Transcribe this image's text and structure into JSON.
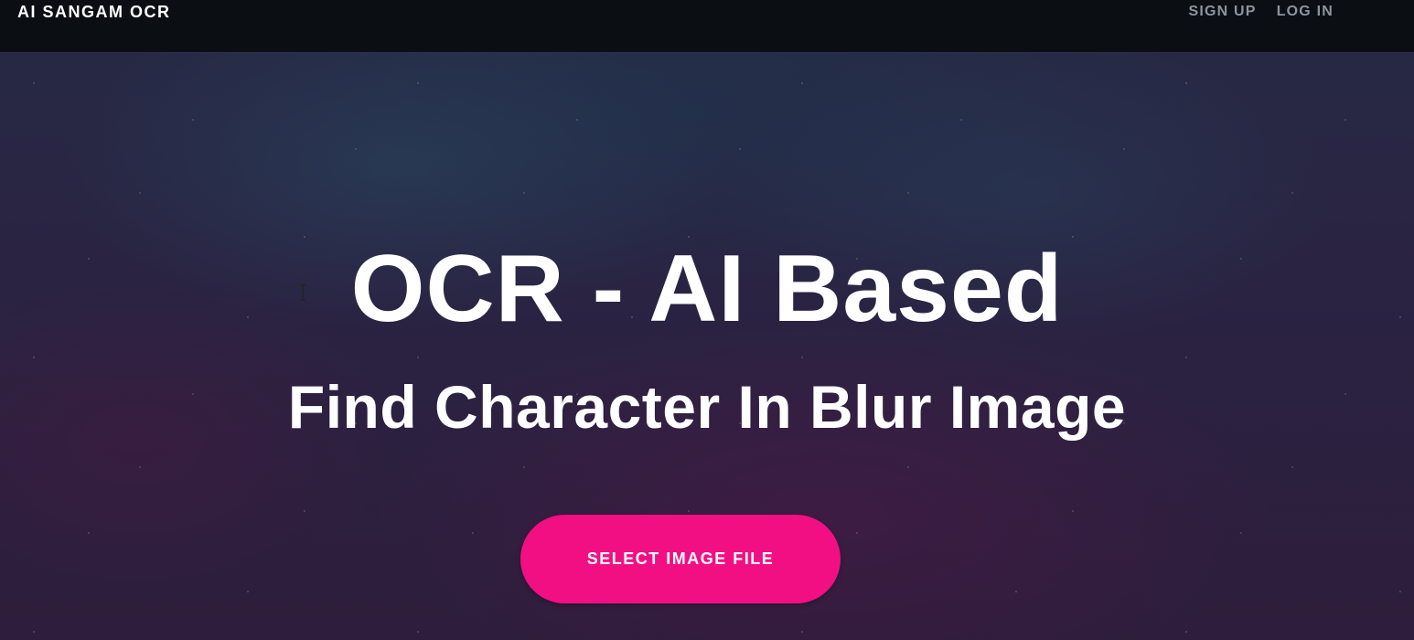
{
  "navbar": {
    "brand": "AI SANGAM OCR",
    "links": [
      {
        "label": "SIGN UP"
      },
      {
        "label": "LOG IN"
      }
    ]
  },
  "hero": {
    "title": "OCR - AI Based",
    "subtitle": "Find Character In Blur Image",
    "button_label": "SELECT IMAGE FILE"
  },
  "colors": {
    "navbar_bg": "#0b0f14",
    "accent": "#f20f83",
    "nav_link": "#8c949e",
    "text": "#ffffff"
  },
  "icons": {
    "cursor": "text-cursor-icon"
  }
}
